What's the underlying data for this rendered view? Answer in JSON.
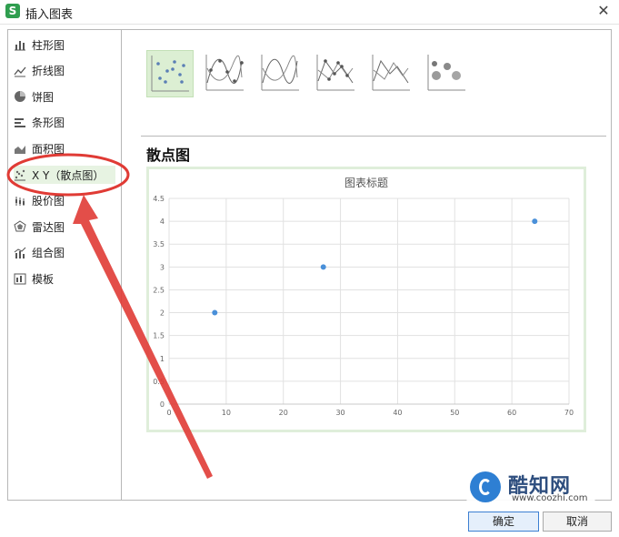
{
  "window": {
    "title": "插入图表",
    "close_glyph": "✕",
    "accent": "#2f9e4f",
    "app_icon_glyph": "S"
  },
  "sidebar": {
    "items": [
      {
        "label": "柱形图",
        "icon": "bar-chart-icon"
      },
      {
        "label": "折线图",
        "icon": "line-chart-icon"
      },
      {
        "label": "饼图",
        "icon": "pie-chart-icon"
      },
      {
        "label": "条形图",
        "icon": "horizontal-bar-chart-icon"
      },
      {
        "label": "面积图",
        "icon": "area-chart-icon"
      },
      {
        "label": "X Y（散点图）",
        "icon": "scatter-chart-icon",
        "selected": true
      },
      {
        "label": "股价图",
        "icon": "stock-chart-icon"
      },
      {
        "label": "雷达图",
        "icon": "radar-chart-icon"
      },
      {
        "label": "组合图",
        "icon": "combo-chart-icon"
      },
      {
        "label": "模板",
        "icon": "template-icon"
      }
    ]
  },
  "subtypes": [
    {
      "icon": "scatter-markers-icon",
      "selected": true
    },
    {
      "icon": "scatter-smooth-markers-icon"
    },
    {
      "icon": "scatter-smooth-lines-icon"
    },
    {
      "icon": "scatter-straight-markers-icon"
    },
    {
      "icon": "scatter-straight-lines-icon"
    },
    {
      "icon": "bubble-icon"
    }
  ],
  "section_title": "散点图",
  "chart_data": {
    "type": "scatter",
    "title": "图表标题",
    "x": [
      8,
      27,
      64
    ],
    "y": [
      2,
      3,
      4
    ],
    "xlim": [
      0,
      70
    ],
    "ylim": [
      0,
      4.5
    ],
    "xticks": [
      "0",
      "10",
      "20",
      "30",
      "40",
      "50",
      "60",
      "70"
    ],
    "yticks": [
      "0",
      "0.5",
      "1",
      "1.5",
      "2",
      "2.5",
      "3",
      "3.5",
      "4",
      "4.5"
    ],
    "grid": true,
    "marker_color": "#4a90d9"
  },
  "buttons": {
    "ok": "确定",
    "cancel": "取消"
  },
  "watermark": {
    "name": "酷知网",
    "url": "www.coozhi.com"
  },
  "annotation": {
    "color": "#e03b35"
  }
}
